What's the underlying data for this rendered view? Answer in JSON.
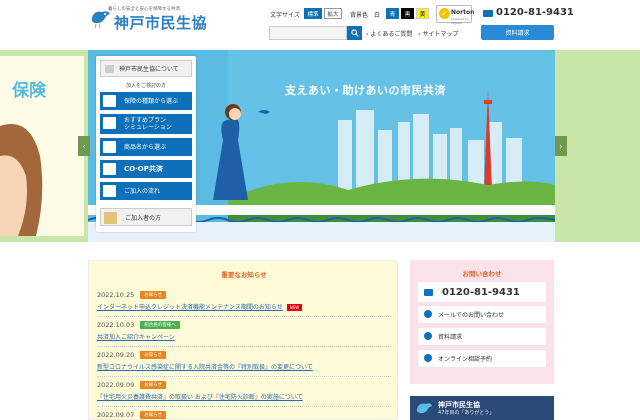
{
  "header": {
    "tagline": "暮らしの安全と安心を保障する共済",
    "logo_text": "神戸市民生協",
    "fontsize_label": "文字サイズ",
    "fontsize_standard": "標準",
    "fontsize_large": "拡大",
    "bg_label": "背景色",
    "bg_white": "白",
    "bg_blue": "青",
    "bg_black": "黒",
    "bg_yellow": "黄",
    "norton_text": "Norton",
    "norton_sub": "powered by digicert",
    "phone": "0120-81-9431",
    "search_placeholder": "",
    "faq": "よくあるご質問",
    "sitemap": "サイトマップ",
    "doc_request": "資料請求"
  },
  "hero": {
    "caption": "支えあい・助けあいの市民共済",
    "left_text": "保険"
  },
  "side_menu": {
    "about": "神戸市民生協について",
    "section_title": "加入をご検討の方",
    "items": [
      "保障の種類から選ぶ",
      "おすすめプラン\nシミュレーション",
      "商品名から選ぶ",
      "CO·OP共済",
      "ご加入の流れ"
    ],
    "members": "ご加入者の方"
  },
  "news": {
    "title": "重要なお知らせ",
    "new_label": "NEW",
    "items": [
      {
        "date": "2022.10.25",
        "category": "お知らせ",
        "cat_color": "#e9851e",
        "title": "インターネット申込クレジット決済機能メンテナンス期間のお知らせ",
        "is_new": true
      },
      {
        "date": "2022.10.03",
        "category": "組合員の皆様へ",
        "cat_color": "#4caf50",
        "title": "共済加入ご紹介キャンペーン",
        "is_new": false
      },
      {
        "date": "2022.09.20",
        "category": "お知らせ",
        "cat_color": "#e9851e",
        "title": "新型コロナウイルス感染症に関する入院共済金等の『特別取扱』の変更について",
        "is_new": false
      },
      {
        "date": "2022.09.09",
        "category": "お知らせ",
        "cat_color": "#e9851e",
        "title": "『住宅用火災養護費共済』の取扱い および『住宅防火診断』の実施について",
        "is_new": false
      },
      {
        "date": "2022.09.07",
        "category": "お知らせ",
        "cat_color": "#e9851e",
        "title": "",
        "is_new": false
      }
    ]
  },
  "contact": {
    "title": "お問い合わせ",
    "phone": "0120-81-9431",
    "mail": "メールでのお問い合わせ",
    "doc": "資料請求",
    "online": "オンライン相談予約"
  },
  "banner": {
    "title": "神戸市民生協",
    "subtitle": "47年目の「ありがとう」"
  }
}
